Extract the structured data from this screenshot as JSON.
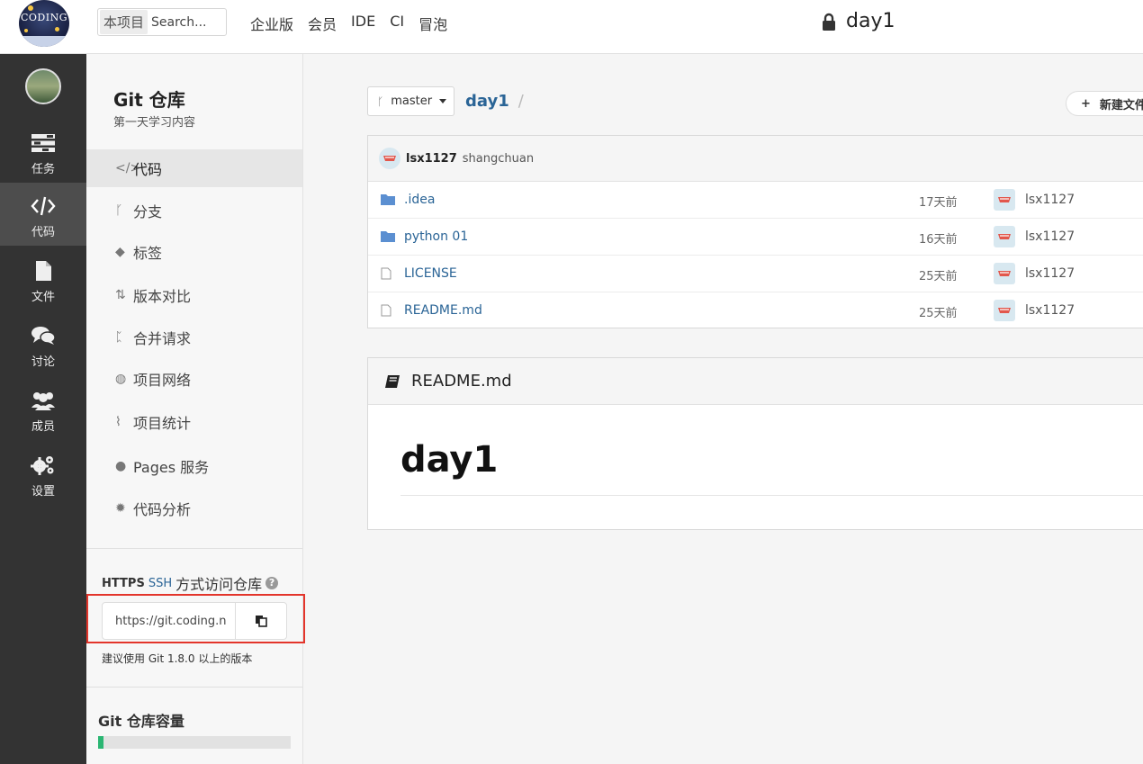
{
  "topbar": {
    "logo_text": "CODING",
    "search_scope": "本项目",
    "search_placeholder": "Search...",
    "nav": [
      "企业版",
      "会员",
      "IDE",
      "CI",
      "冒泡"
    ],
    "repo_name": "day1"
  },
  "leftbar": {
    "items": [
      {
        "label": "任务",
        "icon": "task-list-icon"
      },
      {
        "label": "代码",
        "icon": "code-icon"
      },
      {
        "label": "文件",
        "icon": "file-icon"
      },
      {
        "label": "讨论",
        "icon": "chat-icon"
      },
      {
        "label": "成员",
        "icon": "members-icon"
      },
      {
        "label": "设置",
        "icon": "gear-icon"
      }
    ],
    "active": "代码"
  },
  "subbar": {
    "title": "Git 仓库",
    "description": "第一天学习内容",
    "menu": [
      {
        "label": "代码",
        "icon": "</>"
      },
      {
        "label": "分支",
        "icon": "ᚴ"
      },
      {
        "label": "标签",
        "icon": "◆"
      },
      {
        "label": "版本对比",
        "icon": "⇅"
      },
      {
        "label": "合并请求",
        "icon": "ᛈ"
      },
      {
        "label": "项目网络",
        "icon": "◍"
      },
      {
        "label": "项目统计",
        "icon": "⌇"
      },
      {
        "label": "Pages 服务",
        "icon": "●"
      },
      {
        "label": "代码分析",
        "icon": "✹"
      }
    ],
    "access": {
      "https": "HTTPS",
      "ssh": "SSH",
      "text": "方式访问仓库",
      "url": "https://git.coding.n",
      "hint": "建议使用 Git 1.8.0 以上的版本"
    },
    "capacity": {
      "title": "Git 仓库容量",
      "used_fraction": 0.03
    }
  },
  "main": {
    "branch": "master",
    "breadcrumb_repo": "day1",
    "breadcrumb_sep": "/",
    "new_file": "新建文件",
    "new_file_plus": "+",
    "commit": {
      "author": "lsx1127",
      "message": "shangchuan"
    },
    "files": [
      {
        "name": ".idea",
        "type": "folder",
        "time": "17天前",
        "user": "lsx1127"
      },
      {
        "name": "python 01",
        "type": "folder",
        "time": "16天前",
        "user": "lsx1127"
      },
      {
        "name": "LICENSE",
        "type": "file",
        "time": "25天前",
        "user": "lsx1127"
      },
      {
        "name": "README.md",
        "type": "file",
        "time": "25天前",
        "user": "lsx1127"
      }
    ],
    "readme": {
      "header": "README.md",
      "h1": "day1"
    }
  },
  "colors": {
    "link": "#2a6496",
    "highlight": "#e3352b",
    "sidebar_dark": "#333333",
    "capacity_fill": "#2bb673"
  }
}
